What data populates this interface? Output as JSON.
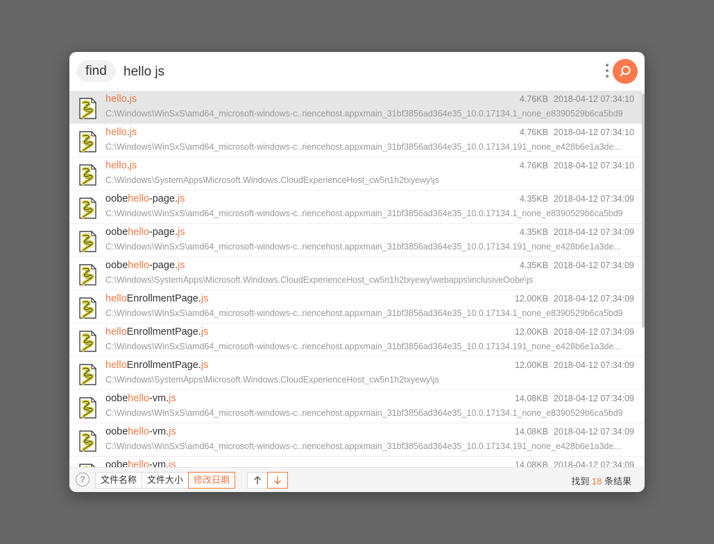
{
  "search": {
    "mode_label": "find",
    "query": "hello js"
  },
  "colors": {
    "accent": "#fa7a4b",
    "highlight_text": "#f07a45",
    "background": "#666666"
  },
  "icons": {
    "search": "search-icon",
    "menu": "more-vertical-icon",
    "file": "js-file-icon",
    "help": "help-icon",
    "sort_up": "arrow-up-icon",
    "sort_down": "arrow-down-icon"
  },
  "results": [
    {
      "name": [
        {
          "t": "hello",
          "h": true
        },
        {
          "t": ".",
          "h": false
        },
        {
          "t": "js",
          "h": true
        }
      ],
      "size": "4.76KB",
      "date": "2018-04-12 07:34:10",
      "path": "C:\\Windows\\WinSxS\\amd64_microsoft-windows-c..riencehost.appxmain_31bf3856ad364e35_10.0.17134.1_none_e8390529b6ca5bd9",
      "selected": true
    },
    {
      "name": [
        {
          "t": "hello",
          "h": true
        },
        {
          "t": ".",
          "h": false
        },
        {
          "t": "js",
          "h": true
        }
      ],
      "size": "4.76KB",
      "date": "2018-04-12 07:34:10",
      "path": "C:\\Windows\\WinSxS\\amd64_microsoft-windows-c..riencehost.appxmain_31bf3856ad364e35_10.0.17134.191_none_e428b6e1a3de...",
      "selected": false
    },
    {
      "name": [
        {
          "t": "hello",
          "h": true
        },
        {
          "t": ".",
          "h": false
        },
        {
          "t": "js",
          "h": true
        }
      ],
      "size": "4.76KB",
      "date": "2018-04-12 07:34:10",
      "path": "C:\\Windows\\SystemApps\\Microsoft.Windows.CloudExperienceHost_cw5n1h2txyewy\\js",
      "selected": false
    },
    {
      "name": [
        {
          "t": "oobe",
          "h": false
        },
        {
          "t": "hello",
          "h": true
        },
        {
          "t": "-page.",
          "h": false
        },
        {
          "t": "js",
          "h": true
        }
      ],
      "size": "4.35KB",
      "date": "2018-04-12 07:34:09",
      "path": "C:\\Windows\\WinSxS\\amd64_microsoft-windows-c..riencehost.appxmain_31bf3856ad364e35_10.0.17134.1_none_e8390529b6ca5bd9",
      "selected": false
    },
    {
      "name": [
        {
          "t": "oobe",
          "h": false
        },
        {
          "t": "hello",
          "h": true
        },
        {
          "t": "-page.",
          "h": false
        },
        {
          "t": "js",
          "h": true
        }
      ],
      "size": "4.35KB",
      "date": "2018-04-12 07:34:09",
      "path": "C:\\Windows\\WinSxS\\amd64_microsoft-windows-c..riencehost.appxmain_31bf3856ad364e35_10.0.17134.191_none_e428b6e1a3de...",
      "selected": false
    },
    {
      "name": [
        {
          "t": "oobe",
          "h": false
        },
        {
          "t": "hello",
          "h": true
        },
        {
          "t": "-page.",
          "h": false
        },
        {
          "t": "js",
          "h": true
        }
      ],
      "size": "4.35KB",
      "date": "2018-04-12 07:34:09",
      "path": "C:\\Windows\\SystemApps\\Microsoft.Windows.CloudExperienceHost_cw5n1h2txyewy\\webapps\\inclusiveOobe\\js",
      "selected": false
    },
    {
      "name": [
        {
          "t": "hello",
          "h": true
        },
        {
          "t": "EnrollmentPage.",
          "h": false
        },
        {
          "t": "js",
          "h": true
        }
      ],
      "size": "12.00KB",
      "date": "2018-04-12 07:34:09",
      "path": "C:\\Windows\\WinSxS\\amd64_microsoft-windows-c..riencehost.appxmain_31bf3856ad364e35_10.0.17134.1_none_e8390529b6ca5bd9",
      "selected": false
    },
    {
      "name": [
        {
          "t": "hello",
          "h": true
        },
        {
          "t": "EnrollmentPage.",
          "h": false
        },
        {
          "t": "js",
          "h": true
        }
      ],
      "size": "12.00KB",
      "date": "2018-04-12 07:34:09",
      "path": "C:\\Windows\\WinSxS\\amd64_microsoft-windows-c..riencehost.appxmain_31bf3856ad364e35_10.0.17134.191_none_e428b6e1a3de...",
      "selected": false
    },
    {
      "name": [
        {
          "t": "hello",
          "h": true
        },
        {
          "t": "EnrollmentPage.",
          "h": false
        },
        {
          "t": "js",
          "h": true
        }
      ],
      "size": "12.00KB",
      "date": "2018-04-12 07:34:09",
      "path": "C:\\Windows\\SystemApps\\Microsoft.Windows.CloudExperienceHost_cw5n1h2txyewy\\js",
      "selected": false
    },
    {
      "name": [
        {
          "t": "oobe",
          "h": false
        },
        {
          "t": "hello",
          "h": true
        },
        {
          "t": "-vm.",
          "h": false
        },
        {
          "t": "js",
          "h": true
        }
      ],
      "size": "14.08KB",
      "date": "2018-04-12 07:34:09",
      "path": "C:\\Windows\\WinSxS\\amd64_microsoft-windows-c..riencehost.appxmain_31bf3856ad364e35_10.0.17134.1_none_e8390529b6ca5bd9",
      "selected": false
    },
    {
      "name": [
        {
          "t": "oobe",
          "h": false
        },
        {
          "t": "hello",
          "h": true
        },
        {
          "t": "-vm.",
          "h": false
        },
        {
          "t": "js",
          "h": true
        }
      ],
      "size": "14.08KB",
      "date": "2018-04-12 07:34:09",
      "path": "C:\\Windows\\WinSxS\\amd64_microsoft-windows-c..riencehost.appxmain_31bf3856ad364e35_10.0.17134.191_none_e428b6e1a3de...",
      "selected": false
    },
    {
      "name": [
        {
          "t": "oobe",
          "h": false
        },
        {
          "t": "hello",
          "h": true
        },
        {
          "t": "-vm.",
          "h": false
        },
        {
          "t": "js",
          "h": true
        }
      ],
      "size": "14.08KB",
      "date": "2018-04-12 07:34:09",
      "path": "",
      "selected": false
    }
  ],
  "footer": {
    "help_label": "?",
    "sort_options": [
      {
        "label": "文件名称",
        "active": false
      },
      {
        "label": "文件大小",
        "active": false
      },
      {
        "label": "修改日期",
        "active": true
      }
    ],
    "sort_direction": "descending",
    "count_prefix": "找到 ",
    "count": "18",
    "count_suffix": " 条结果"
  }
}
